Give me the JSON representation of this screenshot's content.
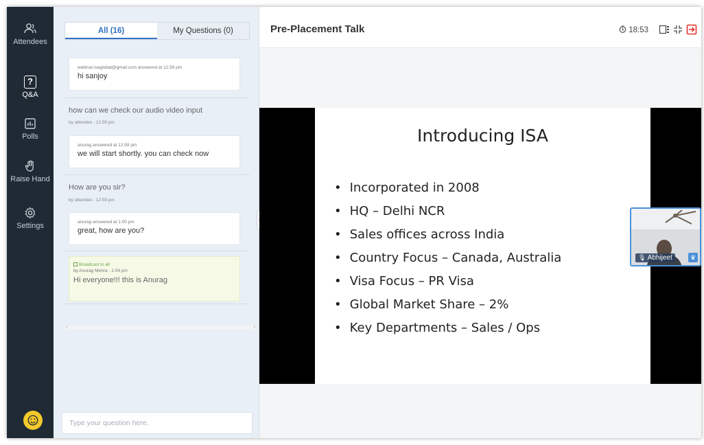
{
  "rail": {
    "items": [
      {
        "label": "Attendees",
        "icon": "people-icon"
      },
      {
        "label": "Q&A",
        "icon": "question-icon"
      },
      {
        "label": "Polls",
        "icon": "chart-icon"
      },
      {
        "label": "Raise Hand",
        "icon": "hand-icon"
      },
      {
        "label": "Settings",
        "icon": "gear-icon"
      }
    ],
    "emoji_icon": "emoji-icon"
  },
  "qa": {
    "tabs": [
      {
        "label": "All (16)",
        "active": true
      },
      {
        "label": "My Questions (0)",
        "active": false
      }
    ],
    "thread": [
      {
        "answer_meta": "webinar.isaglobal@gmail.com answered at 12:59 pm",
        "answer_text": "hi sanjoy"
      },
      {
        "question": "how can we check our audio video input",
        "question_meta": "by attendee - 12:59 pm",
        "answer_meta": "anurag answered at 12:59 pm",
        "answer_text": "we will start shortly. you can check now"
      },
      {
        "question": "How are you sir?",
        "question_meta": "by attendee - 12:59 pm",
        "answer_meta": "anurag answered at 1:00 pm",
        "answer_text": "great, how are you?"
      }
    ],
    "broadcast": {
      "label": "Broadcast to all",
      "meta": "by Anurag Mehra - 1:04 pm",
      "text": "Hi everyone!!! this is Anurag"
    },
    "input_placeholder": "Type your question here."
  },
  "header": {
    "title": "Pre-Placement Talk",
    "timer": "18:53"
  },
  "slide": {
    "title": "Introducing ISA",
    "bullets": [
      "Incorporated in 2008",
      "HQ – Delhi NCR",
      "Sales offices across India",
      "Country Focus – Canada, Australia",
      "Visa Focus – PR Visa",
      "Global Market Share – 2%",
      "Key Departments – Sales / Ops"
    ]
  },
  "camera": {
    "name": "Abhijeet"
  },
  "colors": {
    "rail_bg": "#1f2a35",
    "accent": "#2f6fc2",
    "exit_red": "#e0332b",
    "emoji_yellow": "#f3c82b"
  }
}
